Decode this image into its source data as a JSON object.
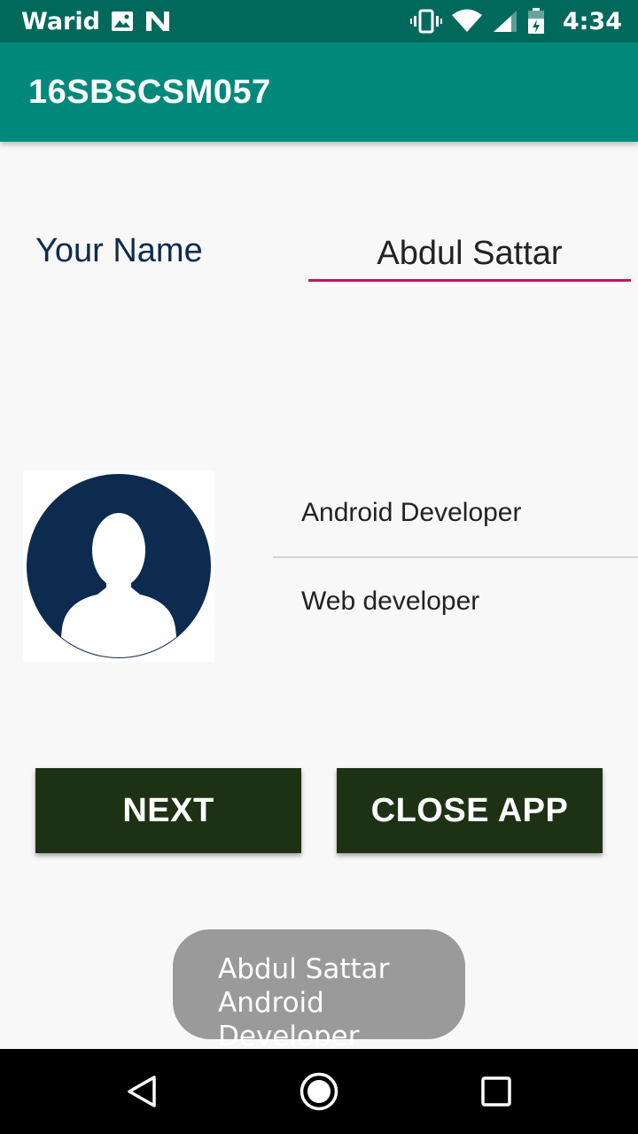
{
  "status_bar": {
    "carrier": "Warid",
    "time": "4:34",
    "icons": [
      "image-icon",
      "n-icon",
      "vibrate-icon",
      "wifi-icon",
      "signal-icon",
      "battery-icon"
    ]
  },
  "app_bar": {
    "title": "16SBSCSM057"
  },
  "form": {
    "name_label": "Your Name",
    "name_value": "Abdul Sattar"
  },
  "profile": {
    "avatar_icon": "user-avatar-icon"
  },
  "list": {
    "items": [
      "Android Developer",
      "Web developer"
    ]
  },
  "buttons": {
    "next_label": "NEXT",
    "close_label": "CLOSE APP"
  },
  "toast": {
    "line1": "Abdul Sattar",
    "line2": "Android Developer"
  },
  "nav": {
    "icons": [
      "back-icon",
      "home-icon",
      "recents-icon"
    ]
  },
  "colors": {
    "status_bar": "#00695c",
    "app_bar": "#00897b",
    "accent": "#c2185b",
    "button": "#1d3114",
    "avatar": "#0d2b4e"
  }
}
